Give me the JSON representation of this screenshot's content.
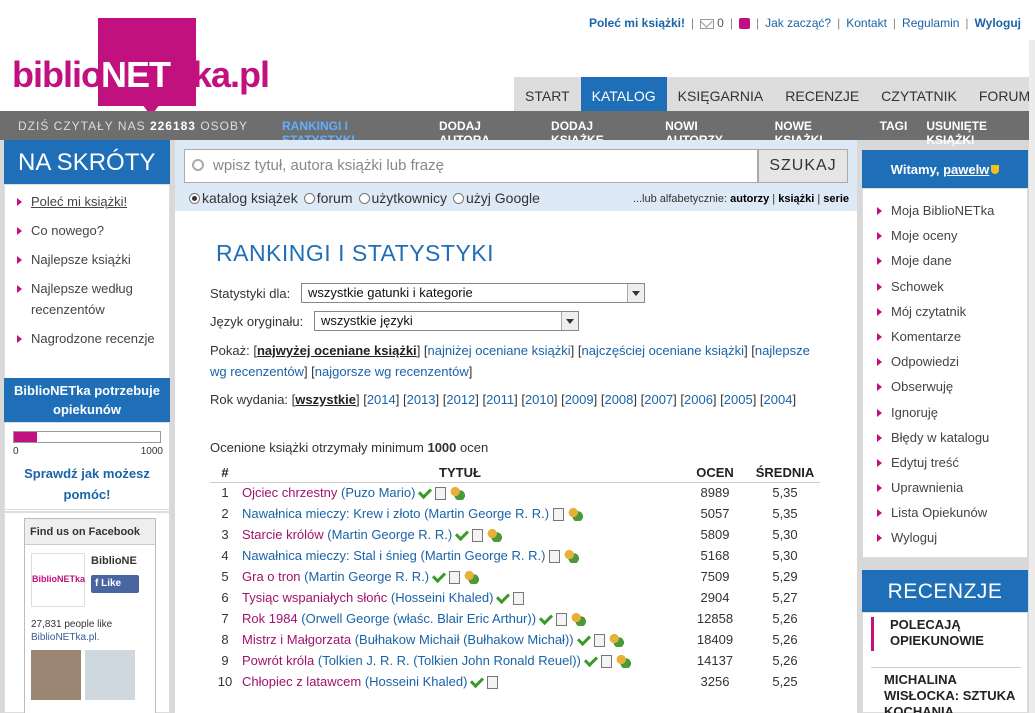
{
  "logo": {
    "part1": "biblio",
    "part2": "NET",
    "part3": "ka.pl"
  },
  "toplinks": {
    "polec": "Poleć mi książki!",
    "mail_count": "0",
    "jak": "Jak zacząć?",
    "kontakt": "Kontakt",
    "regulamin": "Regulamin",
    "wyloguj": "Wyloguj"
  },
  "maintabs": [
    "START",
    "KATALOG",
    "KSIĘGARNIA",
    "RECENZJE",
    "CZYTATNIK",
    "FORUM"
  ],
  "subbar": {
    "reads_label": "DZIŚ CZYTAŁY NAS",
    "reads_count": "226183",
    "reads_suffix": "OSOBY",
    "nav": [
      "RANKINGI I STATYSTYKI",
      "DODAJ AUTORA",
      "DODAJ KSIĄŻKĘ",
      "NOWI AUTORZY",
      "NOWE KSIĄŻKI",
      "TAGI",
      "USUNIĘTE KSIĄŻKI"
    ]
  },
  "left": {
    "title": "NA SKRÓTY",
    "items": [
      "Poleć mi książki!",
      "Co nowego?",
      "Najlepsze książki",
      "Najlepsze według recenzentów",
      "Nagrodzone recenzje"
    ],
    "opiek_title": "BiblioNETka potrzebuje opiekunów",
    "progress_fraction": 0.16,
    "bar_min": "0",
    "bar_max": "1000",
    "sprawdz": "Sprawdź jak możesz pomóc!",
    "fb": {
      "head": "Find us on Facebook",
      "name": "BiblioNE",
      "like": "Like",
      "count": "27,831 people like",
      "page": "BiblioNETka.pl."
    }
  },
  "search": {
    "placeholder": "wpisz tytuł, autora książki lub frazę",
    "button": "SZUKAJ",
    "options": [
      "katalog książek",
      "forum",
      "użytkownicy",
      "użyj Google"
    ],
    "alpha_label": "...lub alfabetycznie:",
    "alpha": [
      "autorzy",
      "książki",
      "serie"
    ]
  },
  "page": {
    "title": "RANKINGI I STATYSTYKI",
    "stat_label": "Statystyki dla:",
    "stat_value": "wszystkie gatunki i kategorie",
    "lang_label": "Język oryginału:",
    "lang_value": "wszystkie języki",
    "show_label": "Pokaż:",
    "show_opts": [
      "najwyżej oceniane książki",
      "najniżej oceniane książki",
      "najczęściej oceniane książki",
      "najlepsze wg recenzentów",
      "najgorsze wg recenzentów"
    ],
    "year_label": "Rok wydania:",
    "years": [
      "wszystkie",
      "2014",
      "2013",
      "2012",
      "2011",
      "2010",
      "2009",
      "2008",
      "2007",
      "2006",
      "2005",
      "2004"
    ],
    "min_info_a": "Ocenione książki otrzymały minimum",
    "min_info_n": "1000",
    "min_info_b": "ocen",
    "cols": [
      "#",
      "TYTUŁ",
      "OCEN",
      "ŚREDNIA"
    ],
    "rows": [
      {
        "n": "1",
        "t": "Ojciec chrzestny",
        "a": "(Puzo Mario)",
        "c": "8989",
        "s": "5,35",
        "m": true,
        "i": [
          "ok",
          "bk",
          "us"
        ]
      },
      {
        "n": "2",
        "t": "Nawałnica mieczy: Krew i złoto",
        "a": "(Martin George R. R.)",
        "c": "5057",
        "s": "5,35",
        "m": false,
        "i": [
          "bk",
          "us"
        ]
      },
      {
        "n": "3",
        "t": "Starcie królów",
        "a": "(Martin George R. R.)",
        "c": "5809",
        "s": "5,30",
        "m": true,
        "i": [
          "ok",
          "bk",
          "us"
        ]
      },
      {
        "n": "4",
        "t": "Nawałnica mieczy: Stal i śnieg",
        "a": "(Martin George R. R.)",
        "c": "5168",
        "s": "5,30",
        "m": false,
        "i": [
          "bk",
          "us"
        ]
      },
      {
        "n": "5",
        "t": "Gra o tron",
        "a": "(Martin George R. R.)",
        "c": "7509",
        "s": "5,29",
        "m": true,
        "i": [
          "ok",
          "bk",
          "us"
        ]
      },
      {
        "n": "6",
        "t": "Tysiąc wspaniałych słońc",
        "a": "(Hosseini Khaled)",
        "c": "2904",
        "s": "5,27",
        "m": true,
        "i": [
          "ok",
          "bk"
        ]
      },
      {
        "n": "7",
        "t": "Rok 1984",
        "a": "(Orwell George (właśc. Blair Eric Arthur))",
        "c": "12858",
        "s": "5,26",
        "m": true,
        "i": [
          "ok",
          "bk",
          "us"
        ]
      },
      {
        "n": "8",
        "t": "Mistrz i Małgorzata",
        "a": "(Bułhakow Michaił (Bułhakow Michał))",
        "c": "18409",
        "s": "5,26",
        "m": true,
        "i": [
          "ok",
          "bk",
          "us"
        ]
      },
      {
        "n": "9",
        "t": "Powrót króla",
        "a": "(Tolkien J. R. R. (Tolkien John Ronald Reuel))",
        "c": "14137",
        "s": "5,26",
        "m": true,
        "i": [
          "ok",
          "bk",
          "us"
        ]
      },
      {
        "n": "10",
        "t": "Chłopiec z latawcem",
        "a": "(Hosseini Khaled)",
        "c": "3256",
        "s": "5,25",
        "m": true,
        "i": [
          "ok",
          "bk"
        ]
      }
    ]
  },
  "right": {
    "welcome": "Witamy,",
    "user": "pawelw",
    "menu": [
      "Moja BiblioNETka",
      "Moje oceny",
      "Moje dane",
      "Schowek",
      "Mój czytatnik",
      "Komentarze",
      "Odpowiedzi",
      "Obserwuję",
      "Ignoruję",
      "Błędy w katalogu",
      "Edytuj treść",
      "Uprawnienia",
      "Lista Opiekunów",
      "Wyloguj"
    ],
    "rec_title": "RECENZJE",
    "rec1": "POLECAJĄ OPIEKUNOWIE",
    "rec2": "MICHALINA WISŁOCKA: SZTUKA KOCHANIA"
  }
}
